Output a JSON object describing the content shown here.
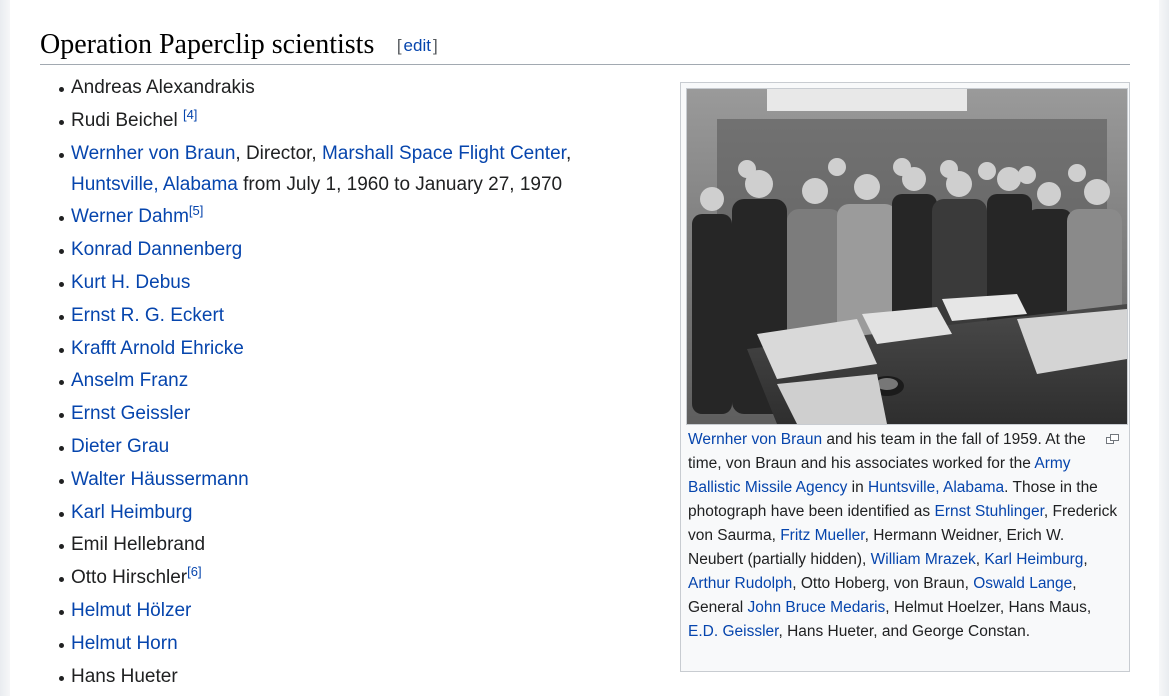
{
  "section": {
    "title": "Operation Paperclip scientists",
    "edit_open": "[",
    "edit_label": "edit",
    "edit_close": "]"
  },
  "people": [
    {
      "parts": [
        {
          "text": "Andreas Alexandrakis",
          "link": false
        }
      ]
    },
    {
      "parts": [
        {
          "text": "Rudi Beichel ",
          "link": false
        },
        {
          "text": "[4]",
          "ref": true
        }
      ]
    },
    {
      "parts": [
        {
          "text": "Wernher von Braun",
          "link": true
        },
        {
          "text": ", Director, ",
          "link": false
        },
        {
          "text": "Marshall Space Flight Center",
          "link": true
        },
        {
          "text": ",",
          "link": false
        },
        {
          "break": true
        },
        {
          "text": "Huntsville, Alabama",
          "link": true
        },
        {
          "text": " from July 1, 1960 to January 27, 1970",
          "link": false
        }
      ]
    },
    {
      "parts": [
        {
          "text": "Werner Dahm",
          "link": true
        },
        {
          "text": "[5]",
          "ref": true
        }
      ]
    },
    {
      "parts": [
        {
          "text": "Konrad Dannenberg",
          "link": true
        }
      ]
    },
    {
      "parts": [
        {
          "text": "Kurt H. Debus",
          "link": true
        }
      ]
    },
    {
      "parts": [
        {
          "text": "Ernst R. G. Eckert",
          "link": true
        }
      ]
    },
    {
      "parts": [
        {
          "text": "Krafft Arnold Ehricke",
          "link": true
        }
      ]
    },
    {
      "parts": [
        {
          "text": "Anselm Franz",
          "link": true
        }
      ]
    },
    {
      "parts": [
        {
          "text": "Ernst Geissler",
          "link": true
        }
      ]
    },
    {
      "parts": [
        {
          "text": "Dieter Grau",
          "link": true
        }
      ]
    },
    {
      "parts": [
        {
          "text": "Walter Häussermann",
          "link": true
        }
      ]
    },
    {
      "parts": [
        {
          "text": "Karl Heimburg",
          "link": true
        }
      ]
    },
    {
      "parts": [
        {
          "text": "Emil Hellebrand",
          "link": false
        }
      ]
    },
    {
      "parts": [
        {
          "text": "Otto Hirschler",
          "link": false
        },
        {
          "text": "[6]",
          "ref": true
        }
      ]
    },
    {
      "parts": [
        {
          "text": "Helmut Hölzer",
          "link": true
        }
      ]
    },
    {
      "parts": [
        {
          "text": "Helmut Horn",
          "link": true
        }
      ]
    },
    {
      "parts": [
        {
          "text": "Hans Hueter",
          "link": false
        }
      ]
    }
  ],
  "caption": [
    {
      "text": "Wernher von Braun",
      "link": true
    },
    {
      "text": " and his team in the fall of 1959. At the time, von Braun and his associates worked for the ",
      "link": false
    },
    {
      "text": "Army Ballistic Missile Agency",
      "link": true
    },
    {
      "text": " in ",
      "link": false
    },
    {
      "text": "Huntsville, Alabama",
      "link": true
    },
    {
      "text": ". Those in the photograph have been identified as ",
      "link": false
    },
    {
      "text": "Ernst Stuhlinger",
      "link": true
    },
    {
      "text": ", Frederick von Saurma, ",
      "link": false
    },
    {
      "text": "Fritz Mueller",
      "link": true
    },
    {
      "text": ", Hermann Weidner, Erich W. Neubert (partially hidden), ",
      "link": false
    },
    {
      "text": "William Mrazek",
      "link": true
    },
    {
      "text": ", ",
      "link": false
    },
    {
      "text": "Karl Heimburg",
      "link": true
    },
    {
      "text": ", ",
      "link": false
    },
    {
      "text": "Arthur Rudolph",
      "link": true
    },
    {
      "text": ", Otto Hoberg, von Braun, ",
      "link": false
    },
    {
      "text": "Oswald Lange",
      "link": true
    },
    {
      "text": ", General ",
      "link": false
    },
    {
      "text": "John Bruce Medaris",
      "link": true
    },
    {
      "text": ", Helmut Hoelzer, Hans Maus, ",
      "link": false
    },
    {
      "text": "E.D. Geissler",
      "link": true
    },
    {
      "text": ", Hans Hueter, and George Constan.",
      "link": false
    }
  ],
  "icons": {
    "enlarge": "magnify-icon"
  },
  "colors": {
    "link": "#0645ad",
    "text": "#202122",
    "rule": "#a2a9b1",
    "thumb_bg": "#f8f9fa"
  }
}
